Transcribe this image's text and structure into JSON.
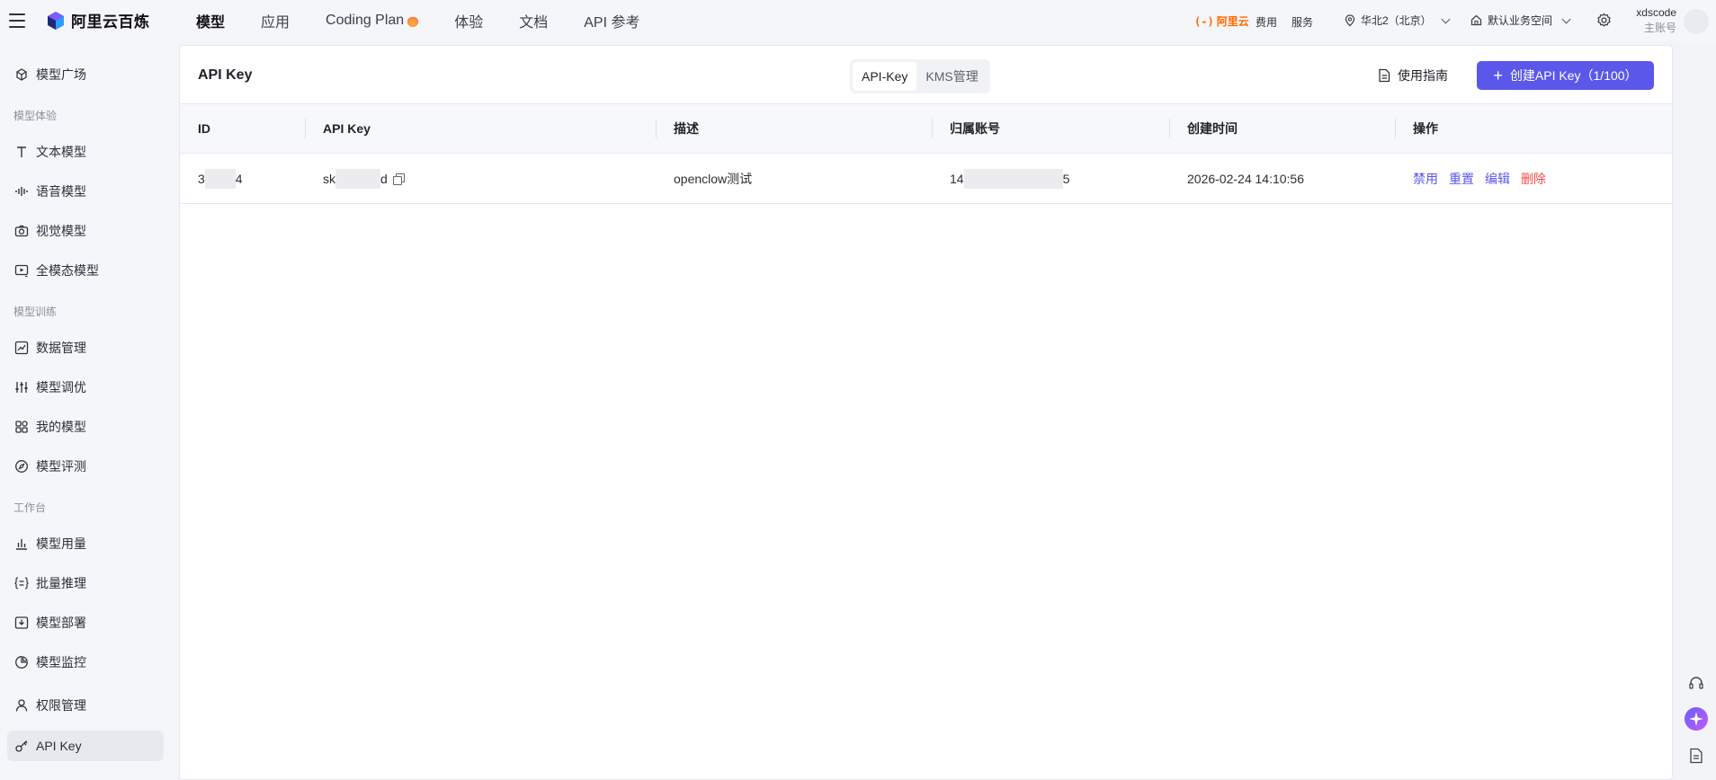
{
  "brand": {
    "name": "阿里云百炼"
  },
  "nav": [
    {
      "label": "模型",
      "active": true
    },
    {
      "label": "应用"
    },
    {
      "label": "Coding Plan"
    },
    {
      "label": "体验"
    },
    {
      "label": "文档"
    },
    {
      "label": "API 参考"
    }
  ],
  "topright": {
    "aliyun": "阿里云",
    "fees": "费用",
    "service": "服务",
    "region": "华北2（北京）",
    "workspace": "默认业务空间",
    "user_name": "xdscode",
    "user_role": "主账号"
  },
  "sidebar": {
    "items": {
      "square": "模型广场",
      "text": "文本模型",
      "voice": "语音模型",
      "vision": "视觉模型",
      "omni": "全模态模型",
      "data": "数据管理",
      "tune": "模型调优",
      "mine": "我的模型",
      "eval": "模型评测",
      "usage": "模型用量",
      "batch": "批量推理",
      "deploy": "模型部署",
      "monitor": "模型监控",
      "perm": "权限管理",
      "apikey": "API Key"
    },
    "groups": {
      "experience": "模型体验",
      "training": "模型训练",
      "workbench": "工作台"
    }
  },
  "main": {
    "title": "API Key",
    "tabs": [
      "API-Key",
      "KMS管理"
    ],
    "guide": "使用指南",
    "create_button": "创建API Key（1/100）",
    "columns": [
      "ID",
      "API Key",
      "描述",
      "归属账号",
      "创建时间",
      "操作"
    ],
    "row": {
      "id_prefix": "3",
      "id_suffix": "4",
      "key_prefix": "sk",
      "key_suffix": "d",
      "description": "openclow测试",
      "account_prefix": "14",
      "account_suffix": "5",
      "created_at": "2026-02-24 14:10:56",
      "actions": [
        "禁用",
        "重置",
        "编辑",
        "删除"
      ]
    }
  },
  "colors": {
    "accent": "#5b57e8",
    "danger": "#f54a45",
    "aliyun_orange": "#ff6a00"
  }
}
